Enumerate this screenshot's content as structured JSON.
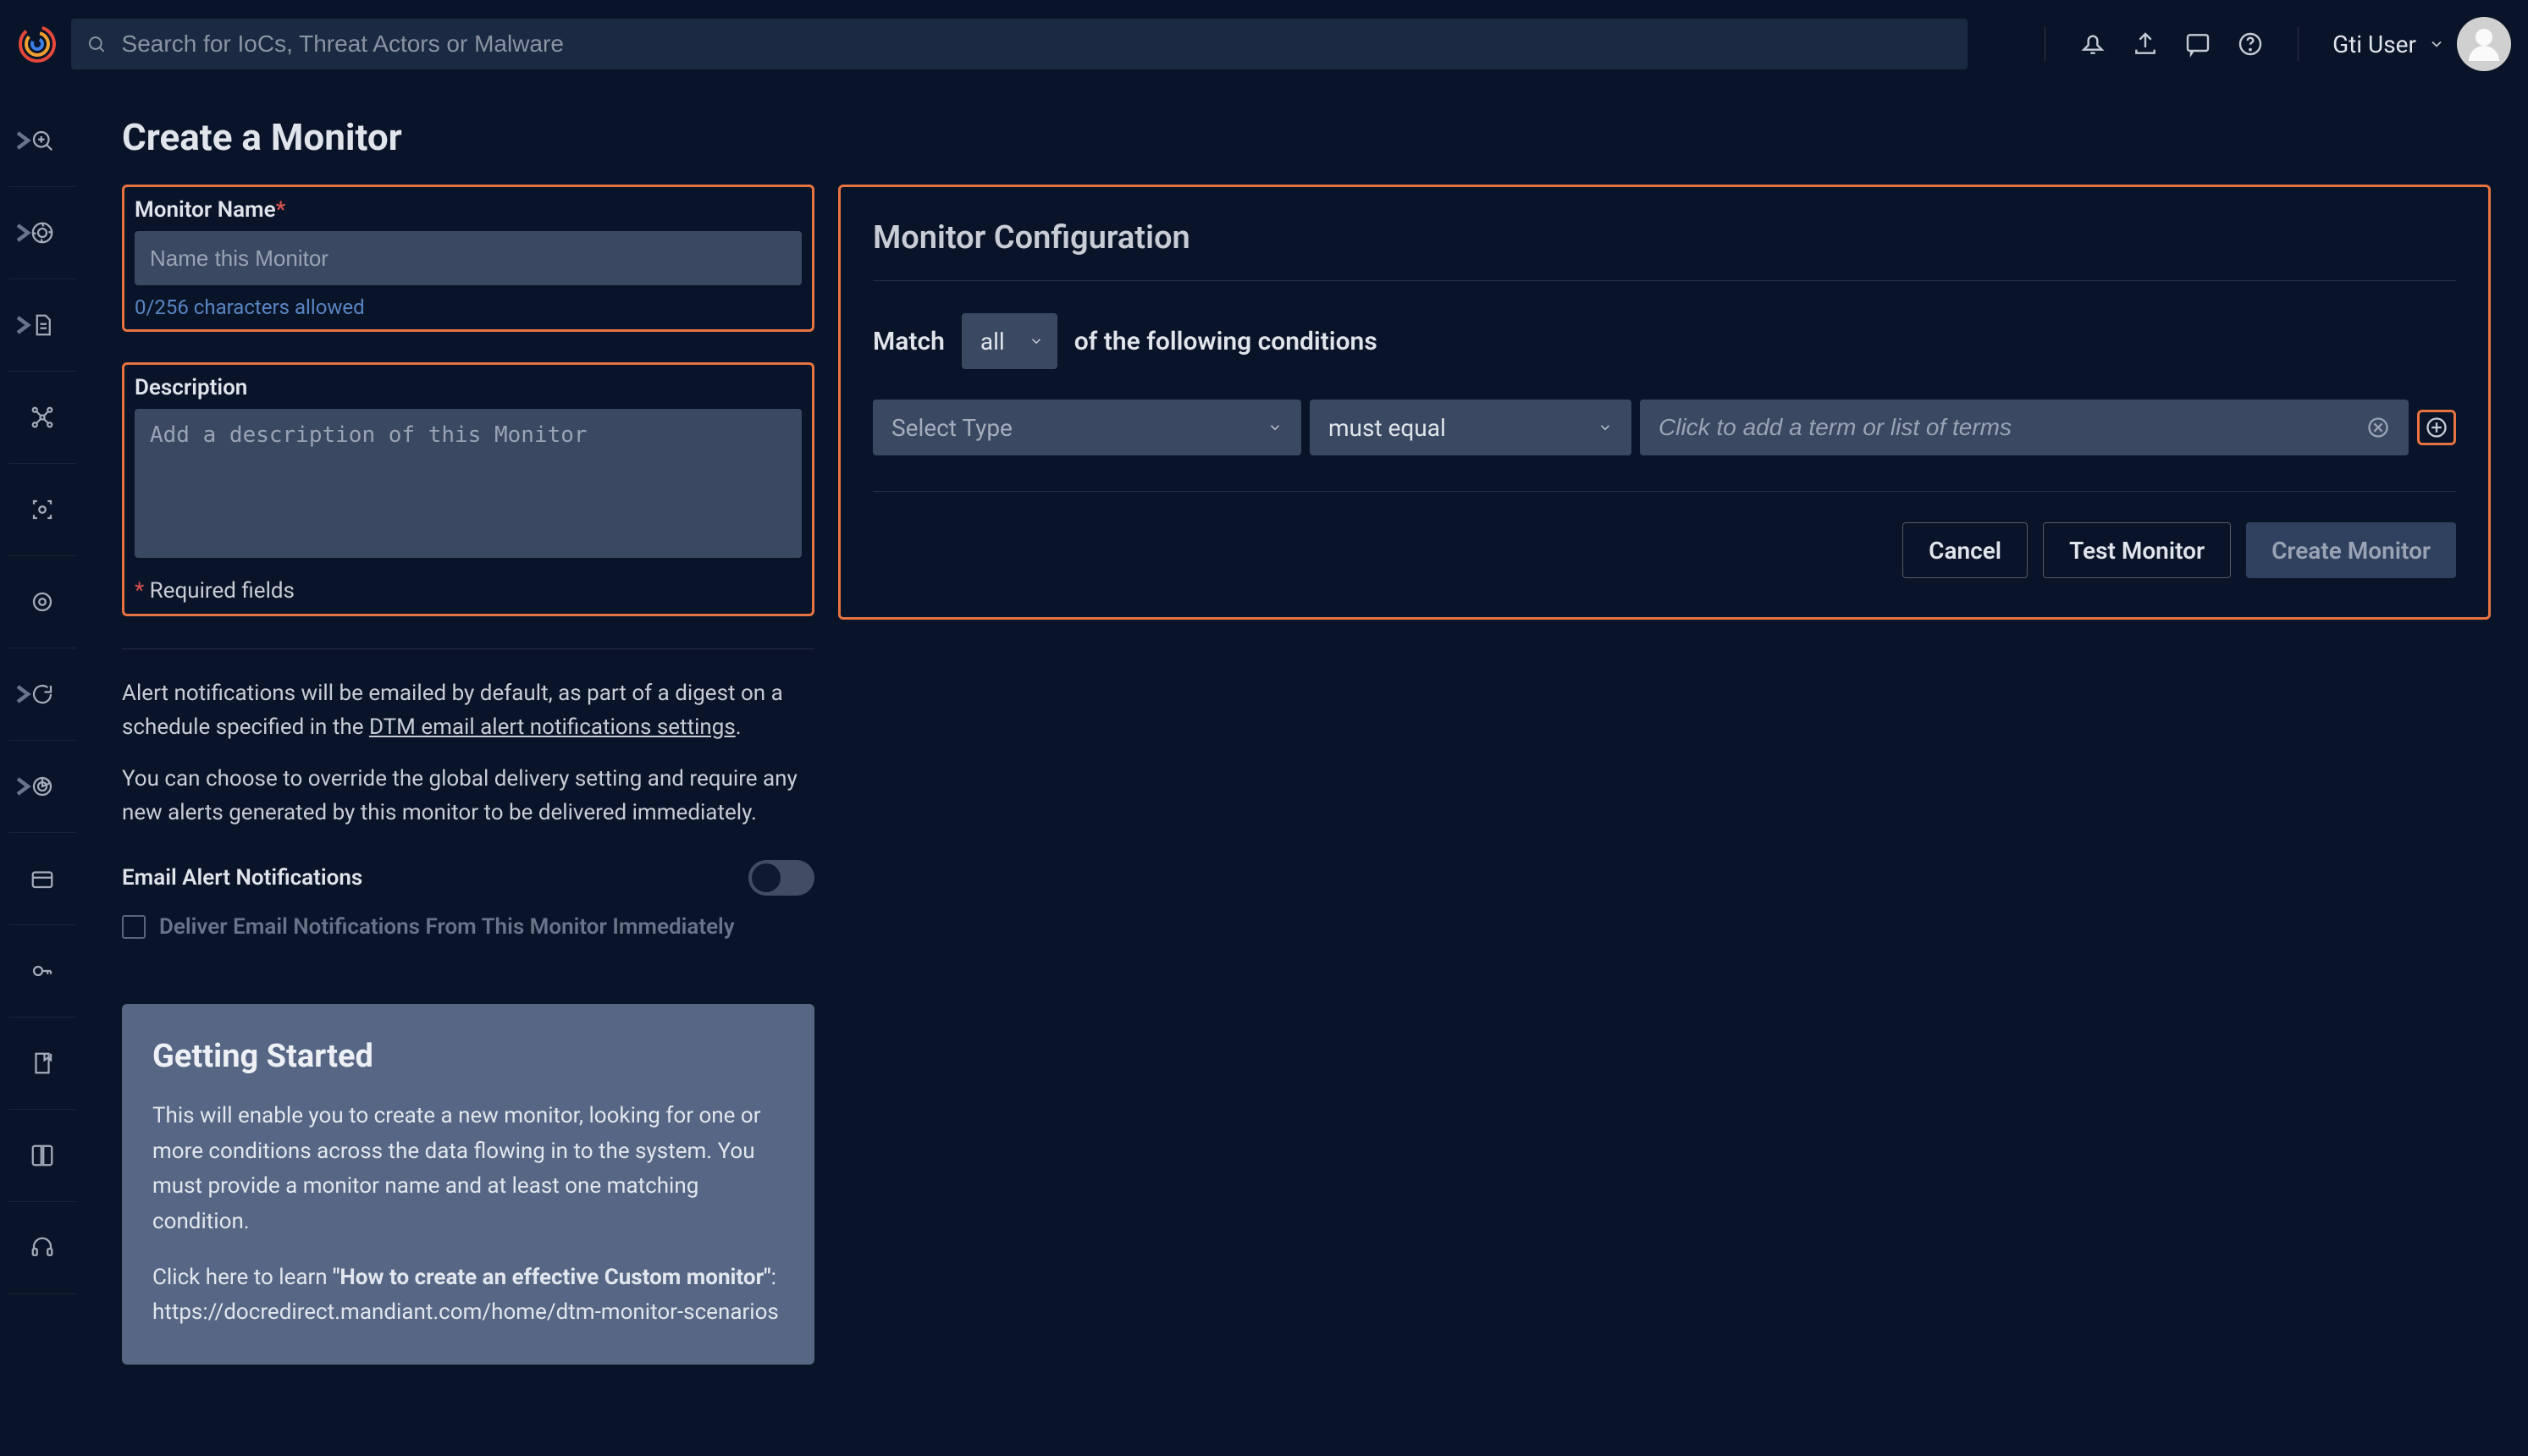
{
  "topbar": {
    "search_placeholder": "Search for IoCs, Threat Actors or Malware",
    "user_name": "Gti User"
  },
  "page": {
    "title": "Create a Monitor"
  },
  "monitor_name": {
    "label": "Monitor Name",
    "placeholder": "Name this Monitor",
    "helper": "0/256 characters allowed"
  },
  "description": {
    "label": "Description",
    "placeholder": "Add a description of this Monitor",
    "required_note": "Required fields"
  },
  "alerts": {
    "paragraph1_a": "Alert notifications will be emailed by default, as part of a digest on a schedule specified in the  ",
    "paragraph1_link": "DTM email alert notifications settings",
    "paragraph1_b": ".",
    "paragraph2": "You can choose to override the global delivery setting and require any new alerts generated by this monitor to be delivered immediately.",
    "notif_label": "Email Alert Notifications",
    "checkbox_label": "Deliver Email Notifications From This Monitor Immediately"
  },
  "getting_started": {
    "title": "Getting Started",
    "p1": "This will enable you to create a new monitor, looking for one or more conditions across the data flowing in to the system. You must provide a monitor name and at least one matching condition.",
    "p2a": "Click here to learn ",
    "p2b": "\"How to create an effective Custom monitor\"",
    "p2c": ": https://docredirect.mandiant.com/home/dtm-monitor-scenarios"
  },
  "config": {
    "title": "Monitor Configuration",
    "match_label": "Match",
    "match_select": "all",
    "match_suffix": "of the following conditions",
    "select_type_placeholder": "Select Type",
    "must_equal": "must equal",
    "term_placeholder": "Click to add a term or list of terms",
    "cancel": "Cancel",
    "test": "Test Monitor",
    "create": "Create Monitor"
  }
}
